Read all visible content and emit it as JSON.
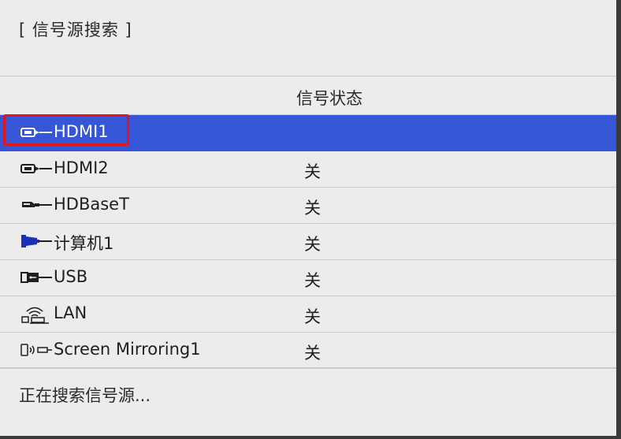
{
  "window": {
    "title": "[ 信号源搜索 ]"
  },
  "table": {
    "column_header": "信号状态"
  },
  "sources": [
    {
      "id": "hdmi1",
      "label": "HDMI1",
      "status": "",
      "icon": "hdmi-plug-icon",
      "selected": true
    },
    {
      "id": "hdmi2",
      "label": "HDMI2",
      "status": "关",
      "icon": "hdmi-plug-icon",
      "selected": false
    },
    {
      "id": "hdbaset",
      "label": "HDBaseT",
      "status": "关",
      "icon": "hdbaset-plug-icon",
      "selected": false
    },
    {
      "id": "computer1",
      "label": "计算机1",
      "status": "关",
      "icon": "vga-plug-icon",
      "selected": false
    },
    {
      "id": "usb",
      "label": "USB",
      "status": "关",
      "icon": "usb-plug-icon",
      "selected": false
    },
    {
      "id": "lan",
      "label": "LAN",
      "status": "关",
      "icon": "lan-wifi-icon",
      "selected": false
    },
    {
      "id": "mirroring1",
      "label": "Screen Mirroring1",
      "status": "关",
      "icon": "screen-mirroring-icon",
      "selected": false
    }
  ],
  "footer": {
    "message": "正在搜索信号源..."
  },
  "colors": {
    "selected_row": "#3556d6",
    "focus_outline": "#e0151c",
    "background": "#ececec"
  }
}
